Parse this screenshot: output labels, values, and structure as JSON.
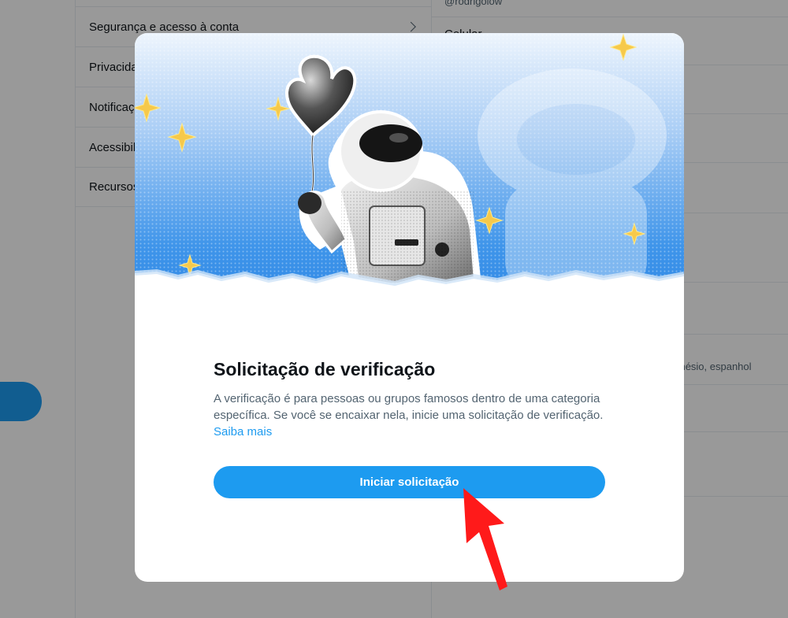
{
  "background": {
    "menu_items": [
      {
        "label": "Segurança e acesso à conta"
      },
      {
        "label": "Privacidade e segurança"
      },
      {
        "label": "Notificações"
      },
      {
        "label": "Acessibilidade, exibição e idiomas"
      },
      {
        "label": "Recursos adicionais"
      }
    ],
    "right_panel": {
      "username": "@rodrigolow",
      "phone_label": "Celular",
      "languages": "donésio, espanhol"
    }
  },
  "modal": {
    "title": "Solicitação de verificação",
    "description": "A verificação é para pessoas ou grupos famosos dentro de uma categoria específica. Se você se encaixar nela, inicie uma solicitação de verificação.",
    "learn_more_label": "Saiba mais",
    "cta_label": "Iniciar solicitação"
  },
  "colors": {
    "accent": "#1d9bf0",
    "annotation_arrow": "#ff1a1a"
  }
}
